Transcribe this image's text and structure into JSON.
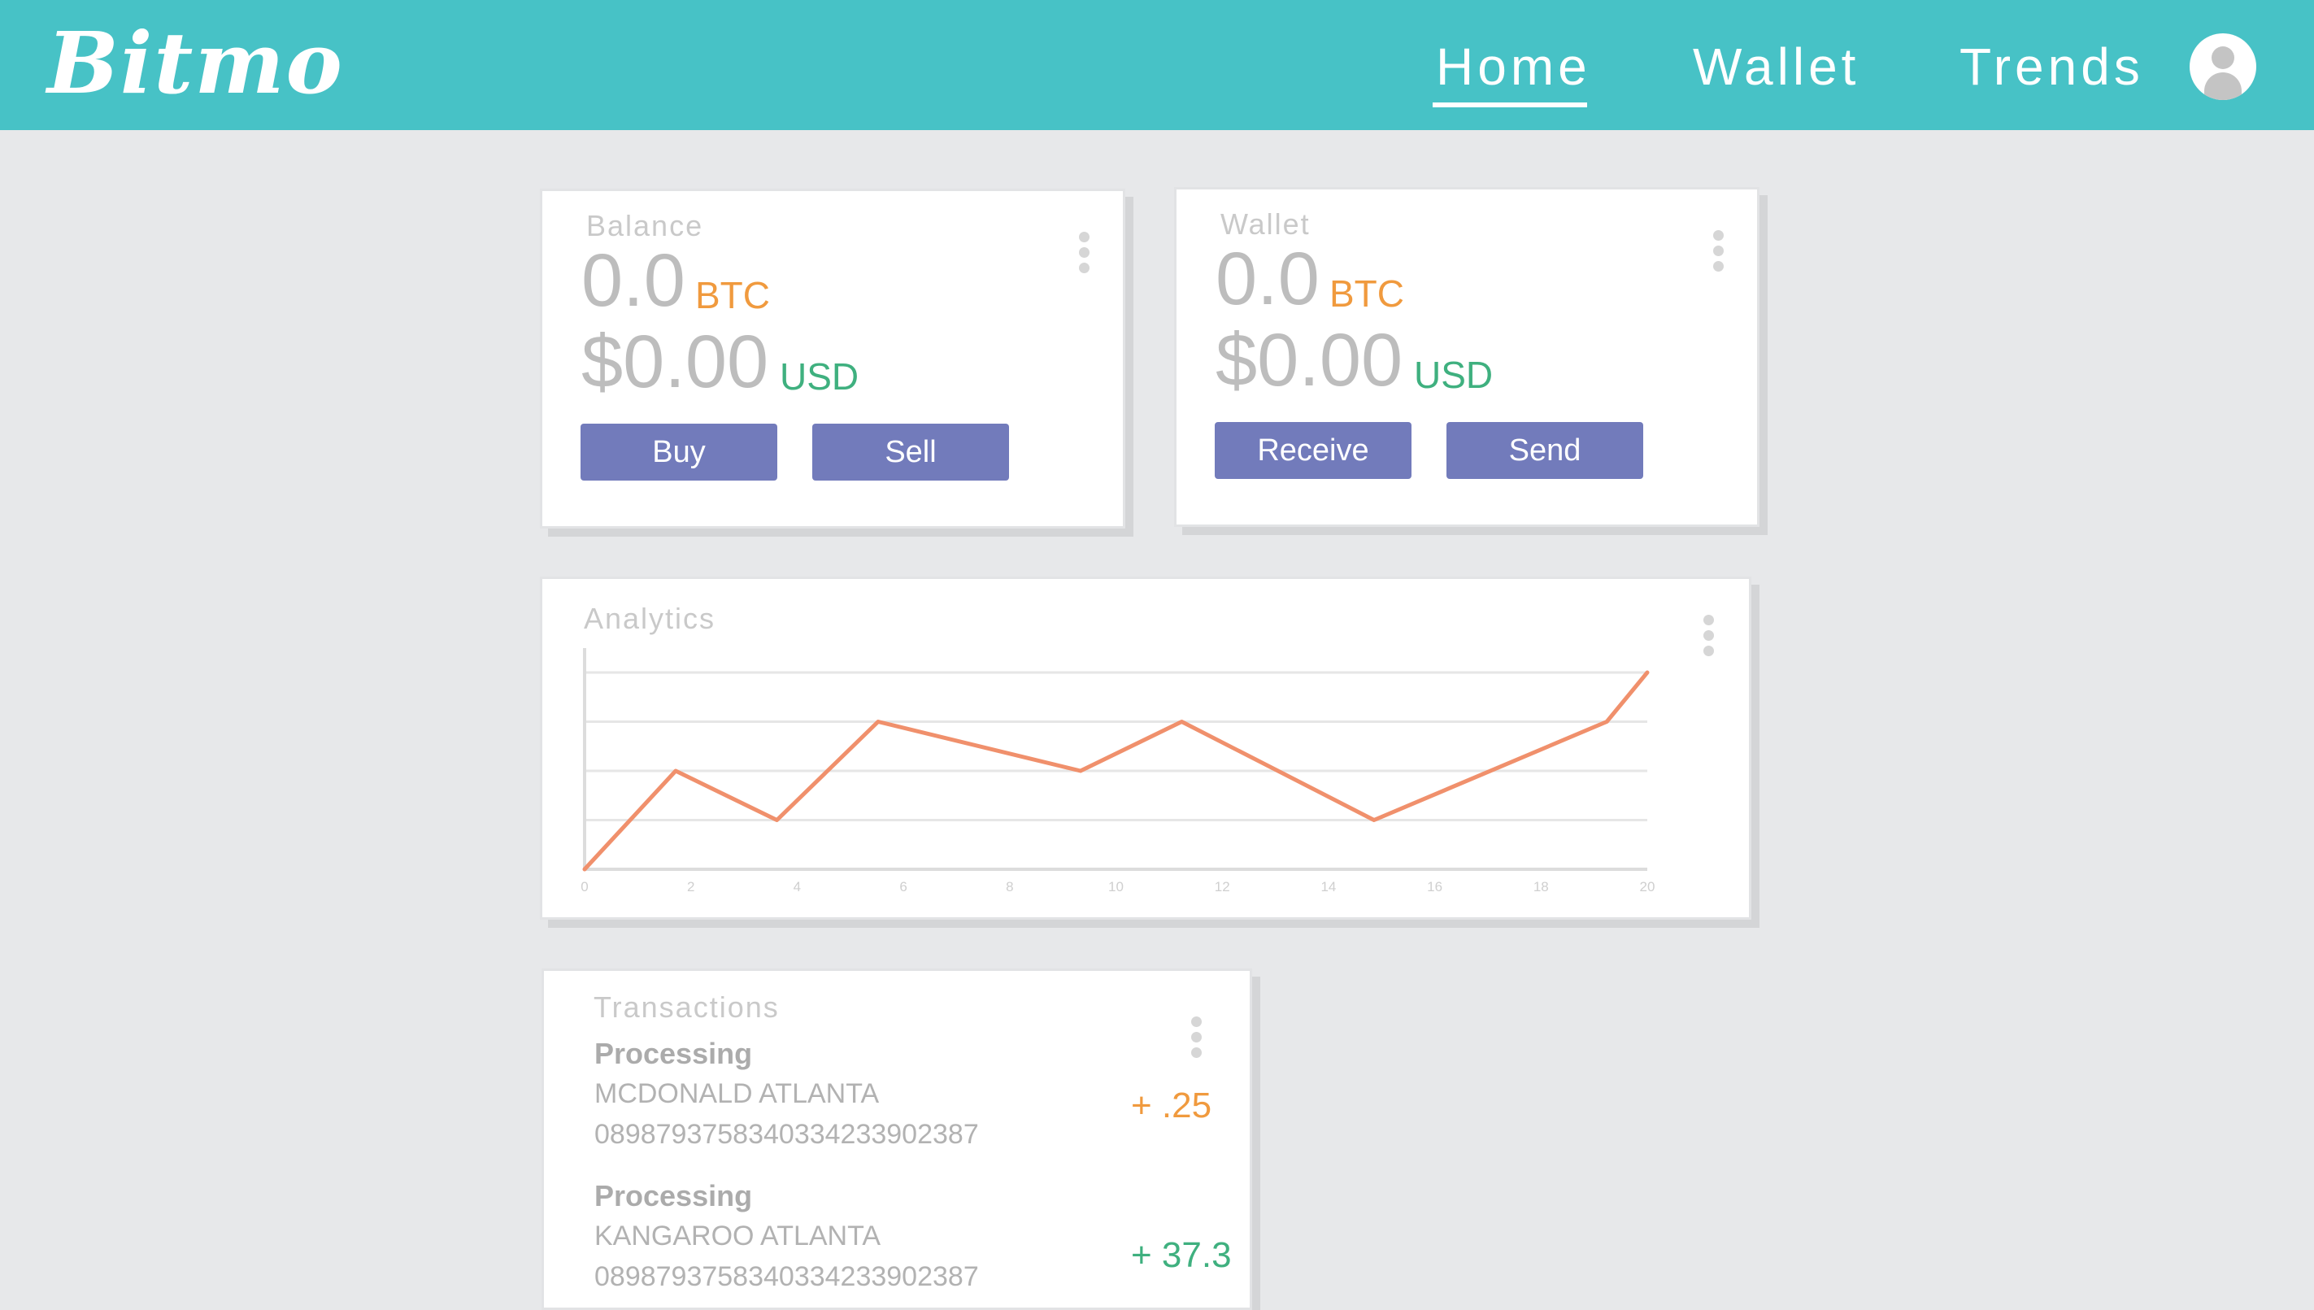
{
  "app": {
    "logo": "Bitmo"
  },
  "nav": {
    "items": [
      {
        "label": "Home",
        "active": true
      },
      {
        "label": "Wallet",
        "active": false
      },
      {
        "label": "Trends",
        "active": false
      }
    ],
    "avatar_icon": "user-avatar-icon"
  },
  "colors": {
    "header": "#47c2c6",
    "background": "#e7e8ea",
    "button": "#727bbb",
    "btc": "#f09a3e",
    "usd": "#3fb07f",
    "chart_line": "#f0906c"
  },
  "balance": {
    "label": "Balance",
    "btc_value": "0.0",
    "btc_unit": "BTC",
    "usd_value": "$0.00",
    "usd_unit": "USD",
    "buttons": {
      "buy": "Buy",
      "sell": "Sell"
    }
  },
  "wallet": {
    "label": "Wallet",
    "btc_value": "0.0",
    "btc_unit": "BTC",
    "usd_value": "$0.00",
    "usd_unit": "USD",
    "buttons": {
      "receive": "Receive",
      "send": "Send"
    }
  },
  "analytics": {
    "label": "Analytics"
  },
  "chart_data": {
    "type": "line",
    "title": "",
    "xlabel": "",
    "ylabel": "",
    "x_ticks": [
      "0",
      "2",
      "4",
      "6",
      "8",
      "10",
      "12",
      "14",
      "16",
      "18",
      "20"
    ],
    "xlim": [
      0,
      21
    ],
    "ylim": [
      0,
      4
    ],
    "grid": true,
    "series": [
      {
        "x": [
          0,
          1.8,
          3.8,
          5.8,
          9.8,
          11.8,
          15.6,
          20.2,
          21
        ],
        "y": [
          0,
          2,
          1,
          3,
          2,
          3,
          1,
          3,
          4.0
        ]
      }
    ]
  },
  "transactions": {
    "label": "Transactions",
    "items": [
      {
        "status": "Processing",
        "merchant": "MCDONALD ATLANTA",
        "id": "0898793758340334233902387",
        "amount": "+ .25",
        "amount_color": "#f09a3e"
      },
      {
        "status": "Processing",
        "merchant": "KANGAROO ATLANTA",
        "id": "0898793758340334233902387",
        "amount": "+ 37.3",
        "amount_color": "#3fb07f"
      }
    ]
  }
}
